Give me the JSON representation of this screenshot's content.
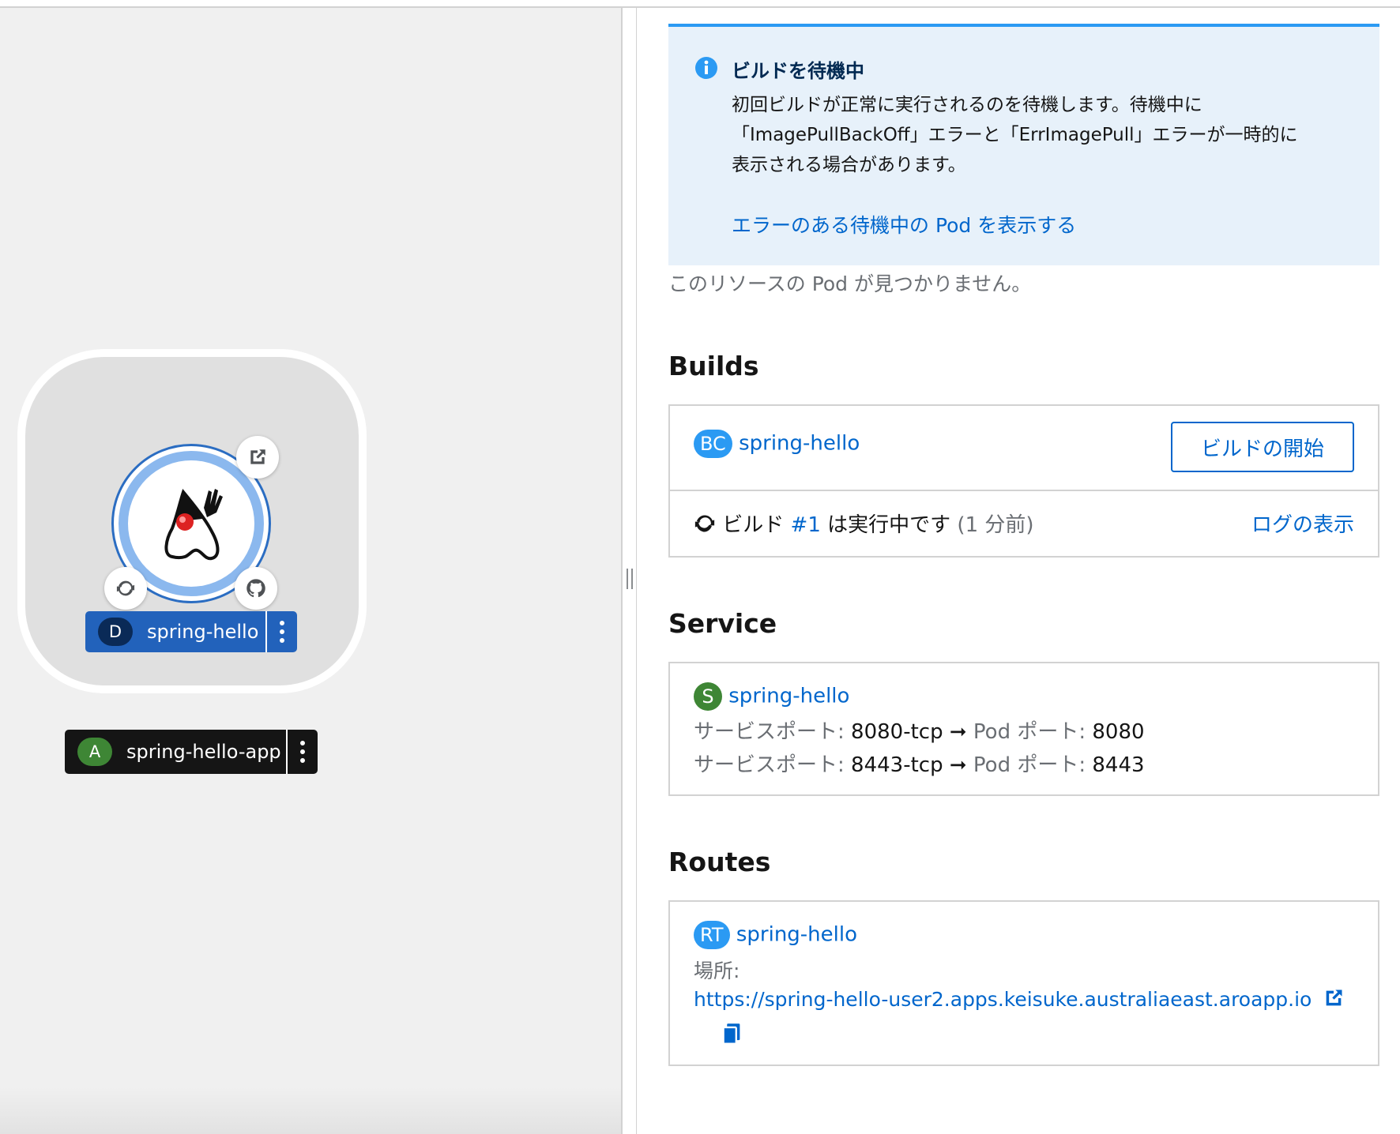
{
  "topology": {
    "workload": {
      "badge": "D",
      "name": "spring-hello"
    },
    "application": {
      "badge": "A",
      "name": "spring-hello-app"
    }
  },
  "alert": {
    "title": "ビルドを待機中",
    "body_line1": "初回ビルドが正常に実行されるのを待機します。待機中に",
    "body_line2": "「ImagePullBackOff」エラーと「ErrImagePull」エラーが一時的に",
    "body_line3": "表示される場合があります。",
    "link": "エラーのある待機中の Pod を表示する"
  },
  "pods": {
    "empty_text": "このリソースの Pod が見つかりません。"
  },
  "builds": {
    "title": "Builds",
    "config": {
      "badge": "BC",
      "name": "spring-hello"
    },
    "start_button": "ビルドの開始",
    "status_prefix": "ビルド",
    "build_number": "#1",
    "status_suffix": "は実行中です",
    "elapsed": "(1 分前)",
    "logs_link": "ログの表示"
  },
  "service": {
    "title": "Service",
    "badge": "S",
    "name": "spring-hello",
    "ports": [
      {
        "service_label": "サービスポート:",
        "service_port": "8080-tcp",
        "pod_label": "Pod ポート:",
        "pod_port": "8080"
      },
      {
        "service_label": "サービスポート:",
        "service_port": "8443-tcp",
        "pod_label": "Pod ポート:",
        "pod_port": "8443"
      }
    ]
  },
  "routes": {
    "title": "Routes",
    "badge": "RT",
    "name": "spring-hello",
    "location_label": "場所:",
    "url": "https://spring-hello-user2.apps.keisuke.australiaeast.aroapp.io"
  },
  "colors": {
    "workload_label": "#2262bb",
    "application_label": "#151515",
    "link": "#0066cc",
    "alert_bg": "#e7f1fa",
    "service_badge": "#3e8635",
    "resource_badge": "#2b9af3"
  }
}
